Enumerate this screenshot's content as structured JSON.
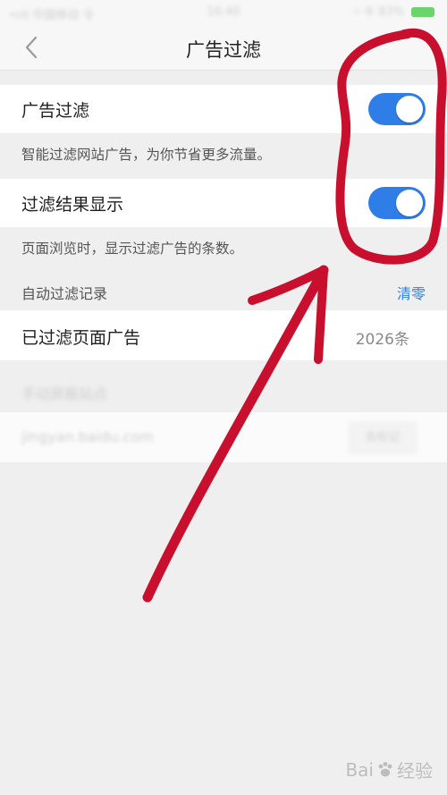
{
  "status_bar": {
    "left": "•ııll 中国移动 令",
    "time": "16:40",
    "right": "⌾ ⑥ 83% "
  },
  "nav": {
    "title": "广告过滤",
    "back_icon": "chevron-left-icon"
  },
  "settings": {
    "ad_filter": {
      "label": "广告过滤",
      "enabled": true,
      "description": "智能过滤网站广告，为你节省更多流量。"
    },
    "result_display": {
      "label": "过滤结果显示",
      "enabled": true,
      "description": "页面浏览时，显示过滤广告的条数。"
    },
    "record": {
      "section_label": "自动过滤记录",
      "clear_label": "清零",
      "filtered_label": "已过滤页面广告",
      "filtered_count": "2026条"
    },
    "manual": {
      "section_label": "手动屏蔽站点",
      "input_value": "jingyan.baidu.com",
      "button_label": "去标记"
    }
  },
  "colors": {
    "accent": "#2f7ee8",
    "link": "#2b7fe0",
    "annotation": "#c8102e",
    "background": "#efeff0"
  },
  "watermark": {
    "brand_left": "Bai",
    "brand_right": "经验"
  }
}
